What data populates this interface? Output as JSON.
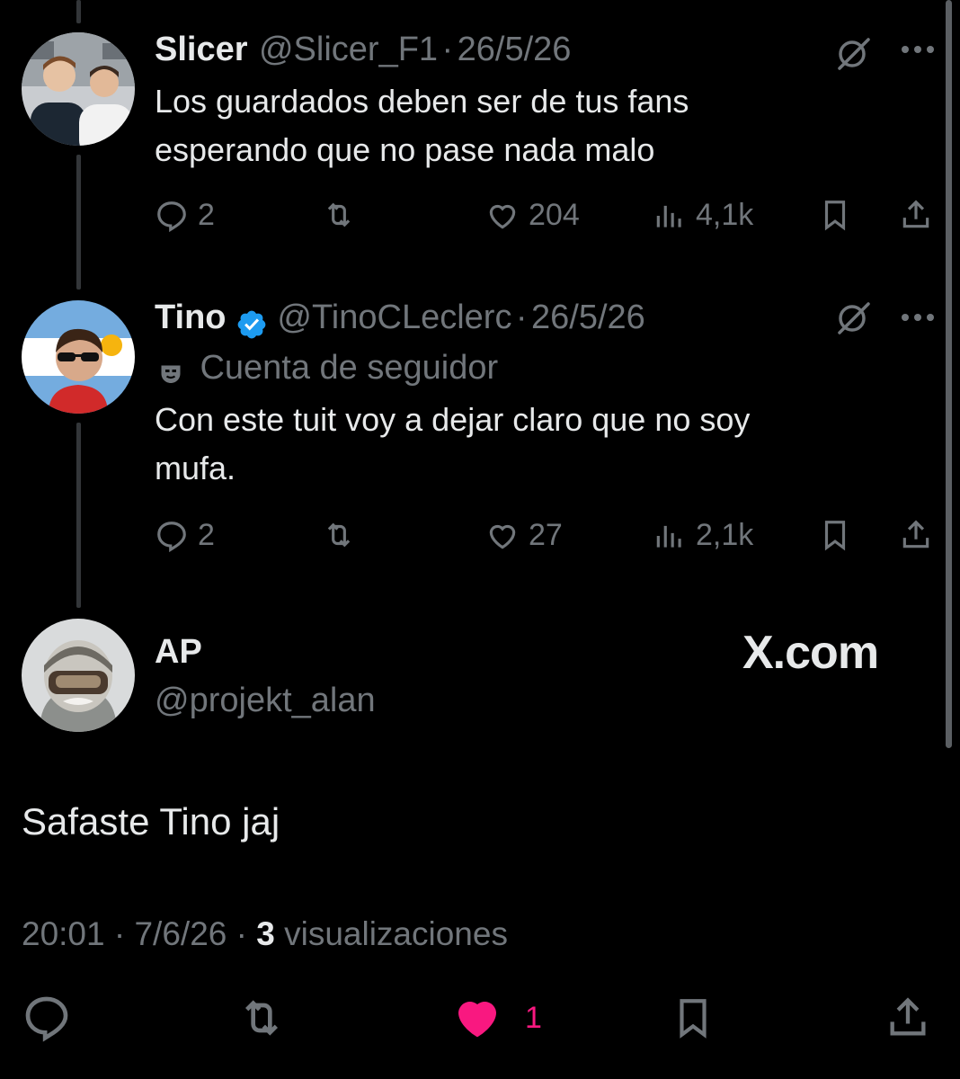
{
  "tweets": [
    {
      "display_name": "Slicer",
      "handle": "@Slicer_F1",
      "separator": "·",
      "date": "26/5/26",
      "text_line1": "Los guardados deben ser de tus fans",
      "text_line2": "esperando que no pase nada malo",
      "replies": "2",
      "likes": "204",
      "views": "4,1k"
    },
    {
      "display_name": "Tino",
      "handle": "@TinoCLeclerc",
      "separator": "·",
      "date": "26/5/26",
      "account_label": "Cuenta de seguidor",
      "text_line1": "Con este tuit voy a dejar claro que no soy",
      "text_line2": "mufa.",
      "replies": "2",
      "likes": "27",
      "views": "2,1k"
    }
  ],
  "main_tweet": {
    "display_name": "AP",
    "handle": "@projekt_alan",
    "watermark": "X.com",
    "text": "Safaste Tino jaj",
    "time": "20:01",
    "sep1": "·",
    "date": "7/6/26",
    "sep2": "·",
    "views_count": "3",
    "views_label": "visualizaciones",
    "likes": "1"
  },
  "colors": {
    "background": "#000000",
    "primary_text": "#e7e9ea",
    "secondary_text": "#71767b",
    "like_active": "#f91880",
    "verified": "#1d9bf0"
  }
}
